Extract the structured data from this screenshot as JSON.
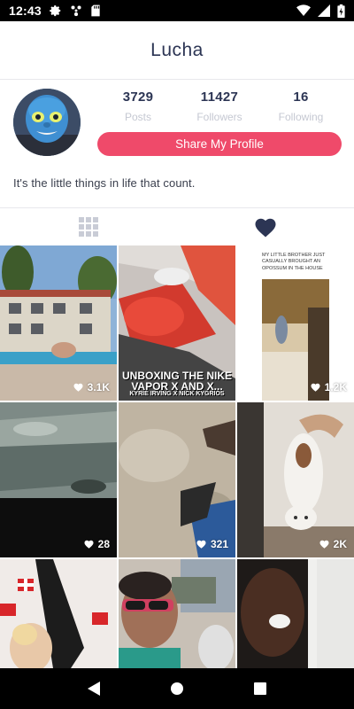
{
  "status_bar": {
    "time": "12:43",
    "icons": [
      "gear-icon",
      "fan-icon",
      "sd-card-icon",
      "wifi-icon",
      "signal-icon",
      "battery-charging-icon"
    ]
  },
  "header": {
    "title": "Lucha"
  },
  "profile": {
    "stats": [
      {
        "value": "3729",
        "label": "Posts"
      },
      {
        "value": "11427",
        "label": "Followers"
      },
      {
        "value": "16",
        "label": "Following"
      }
    ],
    "share_label": "Share My Profile",
    "bio": "It's the little things in life that count."
  },
  "tabs": [
    {
      "icon": "grid-icon",
      "active": false
    },
    {
      "icon": "heart-icon",
      "active": true
    }
  ],
  "grid": {
    "items": [
      {
        "likes": "3.1K"
      },
      {
        "likes": "",
        "overlay_line1": "UNBOXING THE NIKE",
        "overlay_line2": "VAPOR X AND X...",
        "overlay_line3": "KYRIE IRVING X NICK KYGRIOS"
      },
      {
        "likes": "1.2K",
        "caption": "MY LITTLE BROTHER JUST CASUALLY BROUGHT AN OPOSSUM IN THE HOUSE"
      },
      {
        "likes": "28"
      },
      {
        "likes": "321"
      },
      {
        "likes": "2K"
      },
      {
        "likes": ""
      },
      {
        "likes": ""
      },
      {
        "likes": ""
      }
    ]
  },
  "colors": {
    "accent": "#ef4a6a",
    "title": "#2c3554",
    "muted": "#c5c8d2",
    "heart_active": "#2c3554"
  }
}
